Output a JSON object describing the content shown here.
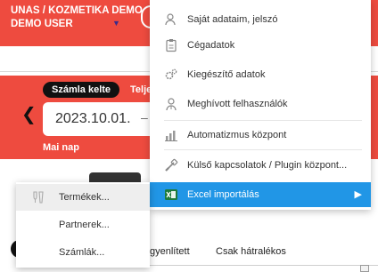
{
  "header": {
    "company": "UNAS / KOZMETIKA DEMO",
    "user": "DEMO USER",
    "user_caret": "▼",
    "avatar_letter": "("
  },
  "date_panel": {
    "active_tab": "Számla kelte",
    "next_tab": "Telje",
    "prev_arrow": "❮",
    "date_value": "2023.10.01.",
    "date_dash": "–",
    "today_link": "Mai nap"
  },
  "bottom_tabs": {
    "paid": "gyenlített",
    "overdue": "Csak hátralékos"
  },
  "menu": {
    "items": [
      {
        "label": "Saját adataim, jelszó",
        "icon": "user-settings-icon"
      },
      {
        "label": "Cégadatok",
        "icon": "clipboard-icon"
      },
      {
        "label": "Kiegészítő adatok",
        "icon": "gears-icon"
      },
      {
        "label": "Meghívott felhasználók",
        "icon": "users-icon"
      },
      {
        "label": "Automatizmus központ",
        "icon": "bar-chart-icon"
      },
      {
        "label": "Külső kapcsolatok / Plugin központ...",
        "icon": "link-icon"
      },
      {
        "label": "Excel importálás",
        "icon": "excel-icon",
        "arrow": "▶"
      }
    ]
  },
  "submenu": {
    "items": [
      {
        "label": "Termékek...",
        "icon": "product-icon"
      },
      {
        "label": "Partnerek..."
      },
      {
        "label": "Számlák..."
      }
    ]
  },
  "colors": {
    "brand_red": "#ee4b3f",
    "highlight_blue": "#2196e6",
    "excel_green": "#1e7b3c"
  }
}
